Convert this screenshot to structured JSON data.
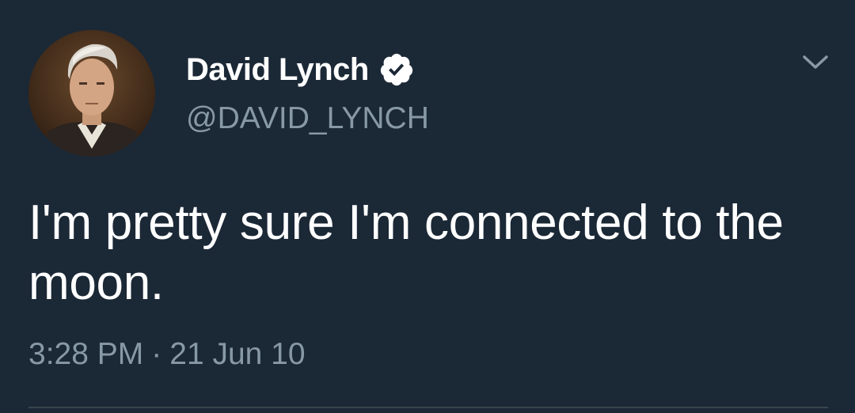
{
  "tweet": {
    "author": {
      "display_name": "David Lynch",
      "handle": "@DAVID_LYNCH",
      "verified": true
    },
    "text": "I'm pretty sure I'm connected to the moon.",
    "time": "3:28 PM",
    "separator": "·",
    "date": "21 Jun 10"
  },
  "icons": {
    "verified": "verified-badge-icon",
    "menu": "chevron-down-icon"
  },
  "colors": {
    "background": "#1b2836",
    "primary_text": "#ffffff",
    "secondary_text": "#8899a6",
    "divider": "#38444d"
  }
}
